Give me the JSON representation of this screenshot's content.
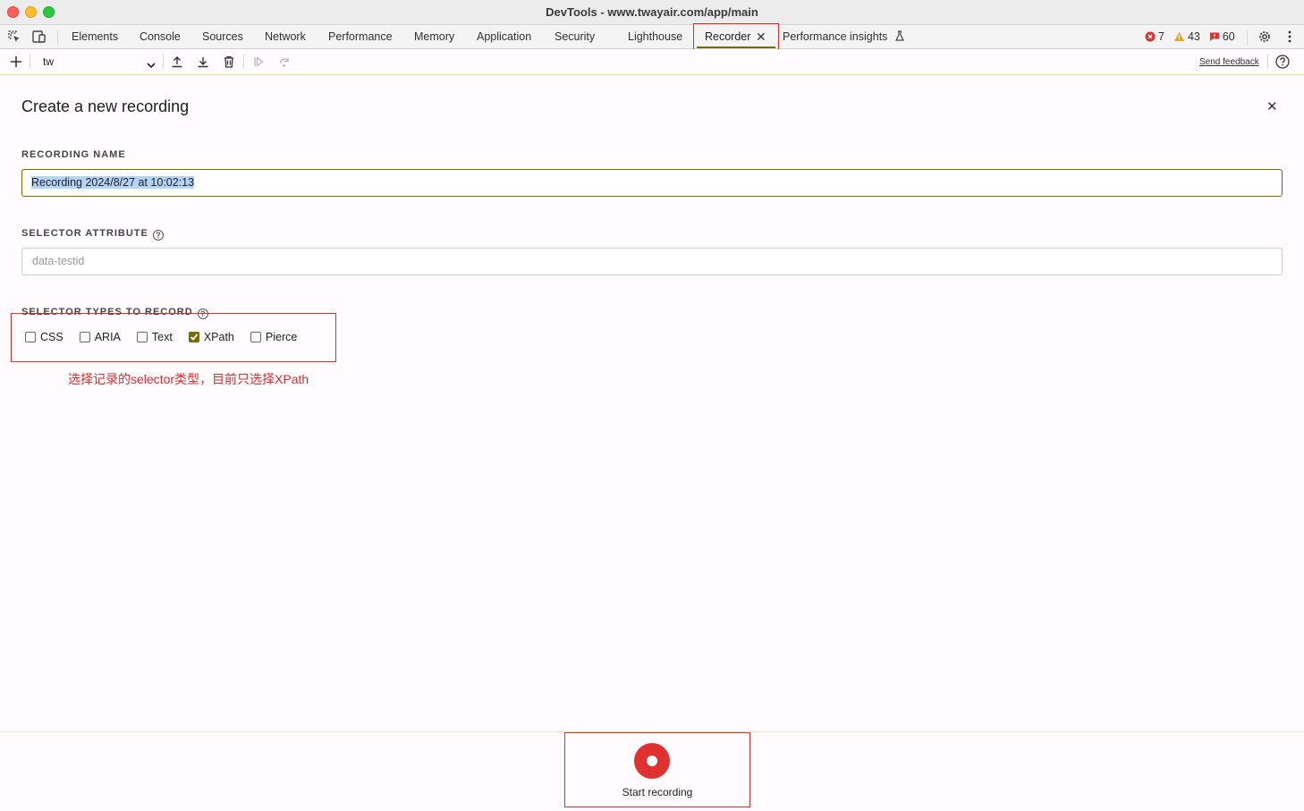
{
  "window": {
    "title": "DevTools - www.twayair.com/app/main"
  },
  "tabs": [
    {
      "label": "Elements"
    },
    {
      "label": "Console"
    },
    {
      "label": "Sources"
    },
    {
      "label": "Network"
    },
    {
      "label": "Performance"
    },
    {
      "label": "Memory"
    },
    {
      "label": "Application"
    },
    {
      "label": "Security"
    },
    {
      "label": "Lighthouse"
    },
    {
      "label": "Recorder",
      "active": true
    },
    {
      "label": "Performance insights"
    }
  ],
  "counters": {
    "errors": "7",
    "warnings": "43",
    "issues": "60"
  },
  "toolbar": {
    "recording_select": "tw",
    "send_feedback": "Send feedback"
  },
  "panel": {
    "title": "Create a new recording",
    "recording_name_label": "RECORDING NAME",
    "recording_name_value": "Recording 2024/8/27 at 10:02:13",
    "selector_attribute_label": "SELECTOR ATTRIBUTE",
    "selector_attribute_placeholder": "data-testid",
    "selector_types_label": "SELECTOR TYPES TO RECORD",
    "selector_types": [
      {
        "label": "CSS",
        "checked": false
      },
      {
        "label": "ARIA",
        "checked": false
      },
      {
        "label": "Text",
        "checked": false
      },
      {
        "label": "XPath",
        "checked": true
      },
      {
        "label": "Pierce",
        "checked": false
      }
    ],
    "annotation": "选择记录的selector类型，目前只选择XPath",
    "start_label": "Start recording"
  },
  "colors": {
    "accent": "#7a6a00",
    "record_red": "#e03131",
    "annotation_red": "#d32f2f"
  }
}
